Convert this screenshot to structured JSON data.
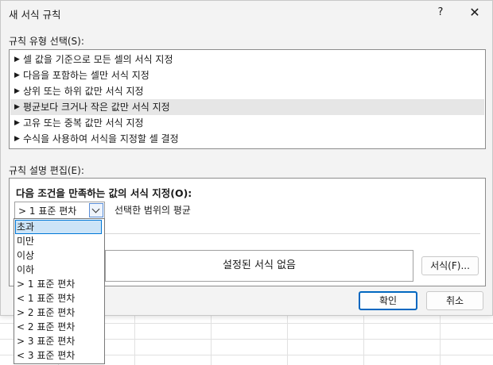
{
  "dialog": {
    "title": "새 서식 규칙",
    "help_label": "?",
    "close_label": "✕"
  },
  "rule_type": {
    "label": "규칙 유형 선택(S):",
    "items": [
      {
        "label": "셀 값을 기준으로 모든 셀의 서식 지정"
      },
      {
        "label": "다음을 포함하는 셀만 서식 지정"
      },
      {
        "label": "상위 또는 하위 값만 서식 지정"
      },
      {
        "label": "평균보다 크거나 작은 값만 서식 지정"
      },
      {
        "label": "고유 또는 중복 값만 서식 지정"
      },
      {
        "label": "수식을 사용하여 서식을 지정할 셀 결정"
      }
    ],
    "arrow": "▶",
    "selected_index": 3
  },
  "rule_edit": {
    "label": "규칙 설명 편집(E):",
    "condition_title": "다음 조건을 만족하는 값의 서식 지정(O):",
    "combo_value": "> 1 표준 편차",
    "range_text": "선택한 범위의 평균",
    "preview_text": "설정된 서식 없음",
    "format_button": "서식(F)..."
  },
  "dropdown": {
    "options": [
      "초과",
      "미만",
      "이상",
      "이하",
      "> 1 표준 편차",
      "< 1 표준 편차",
      "> 2 표준 편차",
      "< 2 표준 편차",
      "> 3 표준 편차",
      "< 3 표준 편차"
    ],
    "highlighted_index": 0
  },
  "buttons": {
    "ok": "확인",
    "cancel": "취소"
  }
}
